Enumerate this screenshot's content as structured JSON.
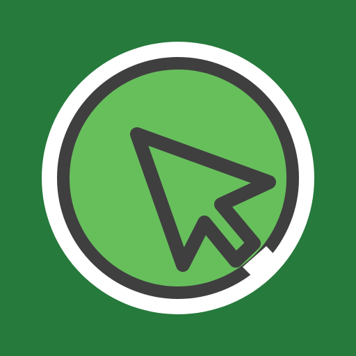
{
  "app_icon": {
    "icon": "cursor-arrow-icon",
    "colors": {
      "background": "#267a3c",
      "ring_outer": "#ffffff",
      "disc_fill": "#67bf5c",
      "stroke": "#3f3f3f"
    }
  }
}
